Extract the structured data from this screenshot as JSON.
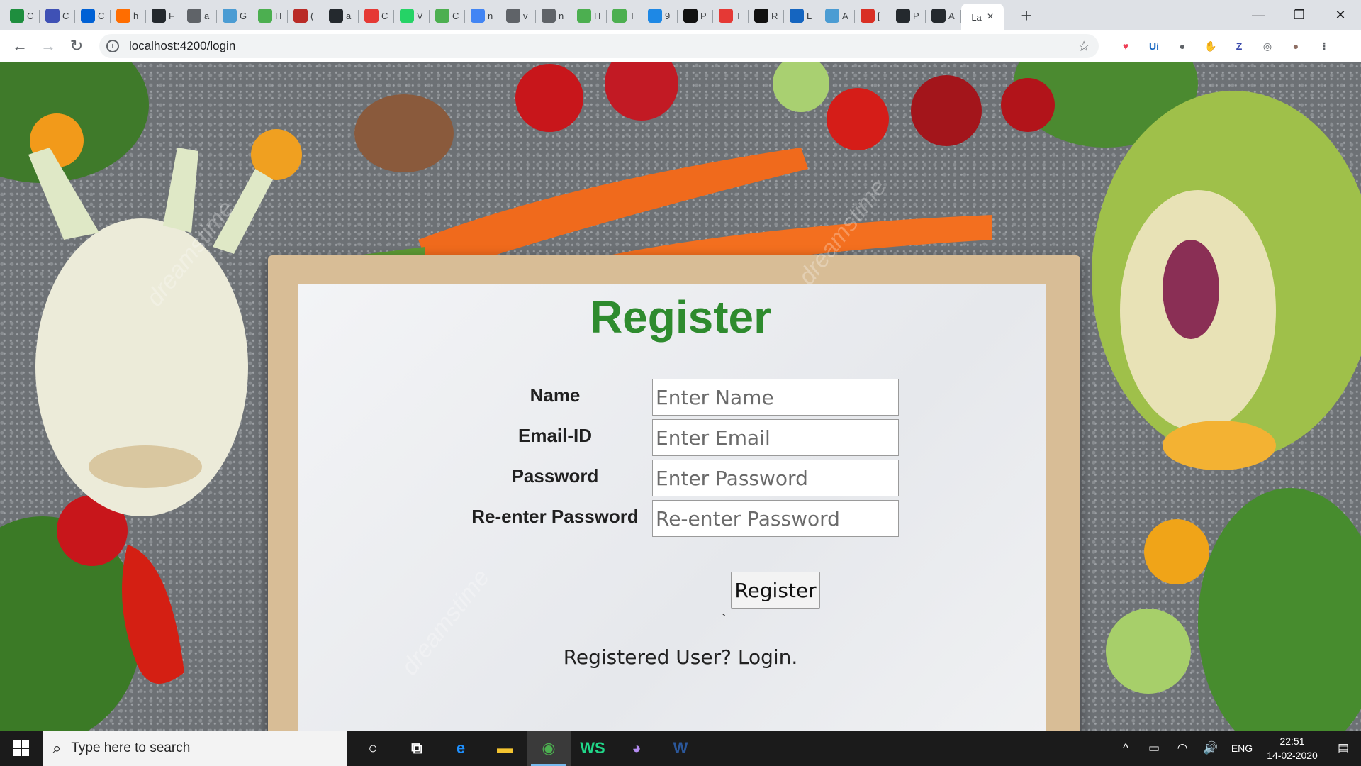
{
  "browser": {
    "tabs": [
      {
        "letter": "C",
        "icon": "plus-square-icon",
        "color": "#1e8e3e"
      },
      {
        "letter": "C",
        "icon": "list-icon",
        "color": "#3f51b5"
      },
      {
        "letter": "C",
        "icon": "box-icon",
        "color": "#0061d5"
      },
      {
        "letter": "h",
        "icon": "dots-icon",
        "color": "#ff6d00"
      },
      {
        "letter": "F",
        "icon": "github-icon",
        "color": "#24292e"
      },
      {
        "letter": "a",
        "icon": "globe-icon",
        "color": "#5f6368"
      },
      {
        "letter": "G",
        "icon": "unc-icon",
        "color": "#4b9cd3"
      },
      {
        "letter": "H",
        "icon": "w3-icon",
        "color": "#4caf50"
      },
      {
        "letter": "(",
        "icon": "quora-icon",
        "color": "#b92b27"
      },
      {
        "letter": "a",
        "icon": "github-icon",
        "color": "#24292e"
      },
      {
        "letter": "C",
        "icon": "figure-icon",
        "color": "#e53935"
      },
      {
        "letter": "V",
        "icon": "whatsapp-icon",
        "color": "#25d366"
      },
      {
        "letter": "C",
        "icon": "w3-icon",
        "color": "#4caf50"
      },
      {
        "letter": "n",
        "icon": "google-icon",
        "color": "#4285f4"
      },
      {
        "letter": "v",
        "icon": "globe-icon",
        "color": "#5f6368"
      },
      {
        "letter": "n",
        "icon": "globe-icon",
        "color": "#5f6368"
      },
      {
        "letter": "H",
        "icon": "w3-icon",
        "color": "#4caf50"
      },
      {
        "letter": "T",
        "icon": "w3-icon",
        "color": "#4caf50"
      },
      {
        "letter": "9",
        "icon": "f-icon",
        "color": "#1e88e5"
      },
      {
        "letter": "P",
        "icon": "codepen-icon",
        "color": "#111111"
      },
      {
        "letter": "T",
        "icon": "target-icon",
        "color": "#e53935"
      },
      {
        "letter": "R",
        "icon": "c-icon",
        "color": "#111111"
      },
      {
        "letter": "L",
        "icon": "wave-icon",
        "color": "#1565c0"
      },
      {
        "letter": "A",
        "icon": "unc-icon",
        "color": "#4b9cd3"
      },
      {
        "letter": "[",
        "icon": "gmail-icon",
        "color": "#d93025"
      },
      {
        "letter": "P",
        "icon": "github-icon",
        "color": "#24292e"
      },
      {
        "letter": "A",
        "icon": "github-icon",
        "color": "#24292e"
      }
    ],
    "active_tab": {
      "title": "La",
      "close": "×"
    },
    "new_tab": "+",
    "window_controls": {
      "minimize": "—",
      "maximize": "❐",
      "close": "✕"
    },
    "nav": {
      "back": "←",
      "forward": "→",
      "reload": "↻"
    },
    "url": "localhost:4200/login",
    "bookmark_star": "☆",
    "extensions": [
      {
        "name": "pocket-icon",
        "glyph": "♥",
        "color": "#ef3f56"
      },
      {
        "name": "ui-extension-icon",
        "glyph": "Ui",
        "color": "#1565c0"
      },
      {
        "name": "circle-extension-icon",
        "glyph": "●",
        "color": "#5f6368"
      },
      {
        "name": "adblock-icon",
        "glyph": "✋",
        "color": "#e53935"
      },
      {
        "name": "z-extension-icon",
        "glyph": "Z",
        "color": "#3949ab"
      },
      {
        "name": "ring-extension-icon",
        "glyph": "◎",
        "color": "#5f6368"
      },
      {
        "name": "profile-avatar",
        "glyph": "●",
        "color": "#8d6e63"
      },
      {
        "name": "menu-icon",
        "glyph": "⋮",
        "color": "#5f6368"
      }
    ]
  },
  "page": {
    "title": "Register",
    "fields": [
      {
        "label": "Name",
        "placeholder": "Enter Name"
      },
      {
        "label": "Email-ID",
        "placeholder": "Enter Email"
      },
      {
        "label": "Password",
        "placeholder": "Enter Password"
      },
      {
        "label": "Re-enter Password",
        "placeholder": "Re-enter Password"
      }
    ],
    "register_button": "Register",
    "stray_mark": "`",
    "login_link": "Registered User? Login.",
    "watermark": "dreamstime",
    "title_color": "#2e8b2e"
  },
  "taskbar": {
    "search_placeholder": "Type here to search",
    "apps": [
      {
        "name": "cortana-icon",
        "glyph": "○"
      },
      {
        "name": "task-view-icon",
        "glyph": "⧉"
      },
      {
        "name": "edge-icon",
        "glyph": "e"
      },
      {
        "name": "file-explorer-icon",
        "glyph": "▬"
      },
      {
        "name": "chrome-icon",
        "glyph": "◉"
      },
      {
        "name": "webstorm-icon",
        "glyph": "WS"
      },
      {
        "name": "github-desktop-icon",
        "glyph": "◕"
      },
      {
        "name": "word-icon",
        "glyph": "W"
      }
    ],
    "tray": {
      "chevron": "^",
      "battery": "▭",
      "wifi": "◠",
      "volume": "🔊",
      "language": "ENG",
      "time": "22:51",
      "date": "14-02-2020",
      "notifications": "▤"
    }
  }
}
